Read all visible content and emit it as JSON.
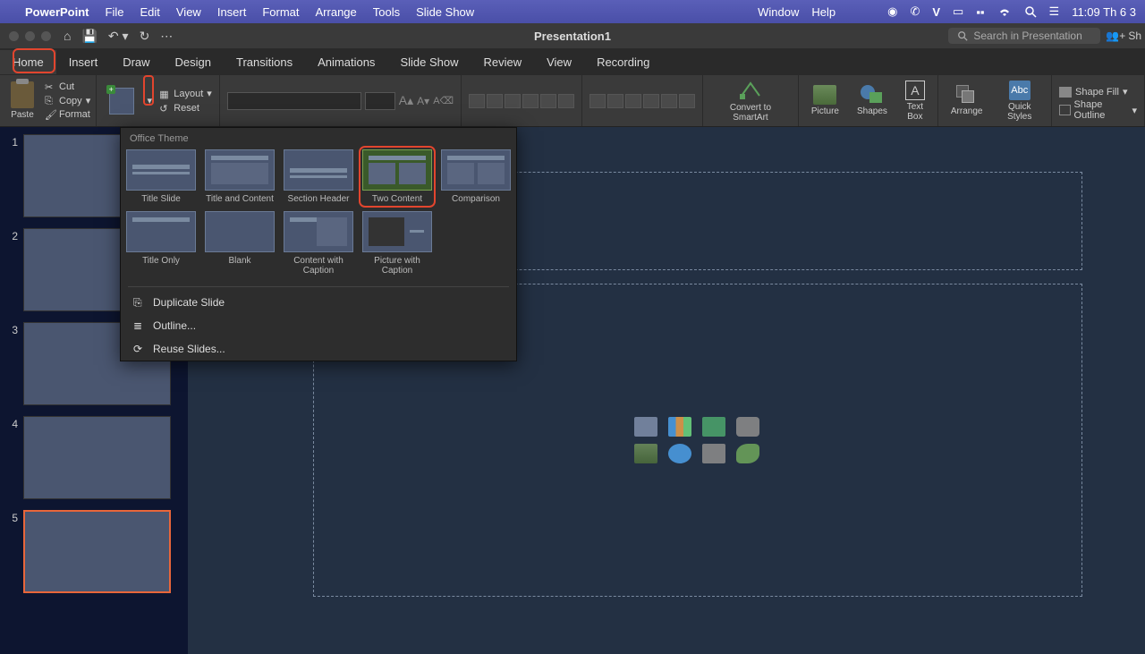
{
  "mac_menu": {
    "app": "PowerPoint",
    "items": [
      "File",
      "Edit",
      "View",
      "Insert",
      "Format",
      "Arrange",
      "Tools",
      "Slide Show"
    ],
    "right_items": [
      "Window",
      "Help"
    ],
    "clock": "11:09 Th 6 3"
  },
  "titlebar": {
    "title": "Presentation1",
    "search_placeholder": "Search in Presentation",
    "share": "Sh"
  },
  "ribbon_tabs": [
    "Home",
    "Insert",
    "Draw",
    "Design",
    "Transitions",
    "Animations",
    "Slide Show",
    "Review",
    "View",
    "Recording"
  ],
  "ribbon": {
    "paste": "Paste",
    "cut": "Cut",
    "copy": "Copy",
    "format": "Format",
    "layout": "Layout",
    "reset": "Reset",
    "convert": "Convert to SmartArt",
    "picture": "Picture",
    "shapes": "Shapes",
    "textbox": "Text Box",
    "arrange": "Arrange",
    "quickstyles": "Quick Styles",
    "shapefill": "Shape Fill",
    "shapeoutline": "Shape Outline"
  },
  "gallery": {
    "header": "Office Theme",
    "layouts": [
      {
        "label": "Title Slide"
      },
      {
        "label": "Title and Content"
      },
      {
        "label": "Section Header"
      },
      {
        "label": "Two Content"
      },
      {
        "label": "Comparison"
      },
      {
        "label": "Title Only"
      },
      {
        "label": "Blank"
      },
      {
        "label": "Content with Caption"
      },
      {
        "label": "Picture with Caption"
      }
    ],
    "menu": {
      "duplicate": "Duplicate Slide",
      "outline": "Outline...",
      "reuse": "Reuse Slides..."
    }
  },
  "slides": {
    "count": 5,
    "selected": 5,
    "title_placeholder": "title"
  }
}
